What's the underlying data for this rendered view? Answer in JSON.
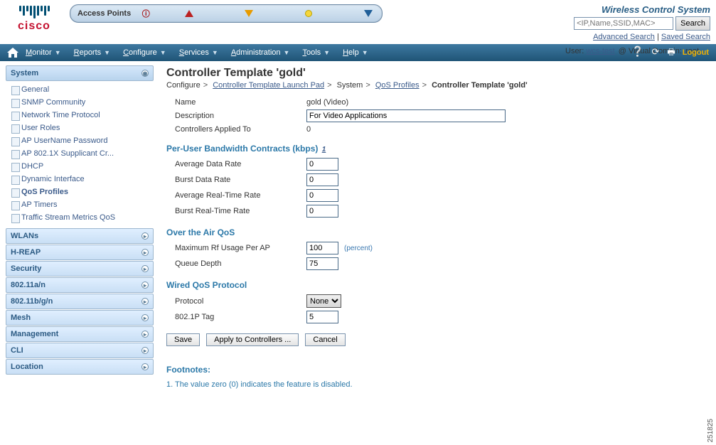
{
  "brand": "cisco",
  "quicknav_label": "Access Points",
  "app_title": "Wireless Control System",
  "search": {
    "placeholder": "<IP,Name,SSID,MAC>",
    "button": "Search",
    "advanced": "Advanced Search",
    "saved": "Saved Search"
  },
  "user_prefix": "User:",
  "user_name": "wcs-test",
  "domain_prefix": "@ Virtual Domain:",
  "domain_value": "root",
  "menubar": {
    "monitor": "Monitor",
    "reports": "Reports",
    "configure": "Configure",
    "services": "Services",
    "administration": "Administration",
    "tools": "Tools",
    "help": "Help",
    "logout": "Logout"
  },
  "sidebar": {
    "system": {
      "title": "System",
      "items": [
        "General",
        "SNMP Community",
        "Network Time Protocol",
        "User Roles",
        "AP UserName Password",
        "AP 802.1X Supplicant Cr...",
        "DHCP",
        "Dynamic Interface",
        "QoS Profiles",
        "AP Timers",
        "Traffic Stream Metrics QoS"
      ],
      "active": "QoS Profiles"
    },
    "sections": [
      "WLANs",
      "H-REAP",
      "Security",
      "802.11a/n",
      "802.11b/g/n",
      "Mesh",
      "Management",
      "CLI",
      "Location"
    ]
  },
  "page": {
    "title": "Controller Template 'gold'",
    "breadcrumb": {
      "configure": "Configure",
      "launch": "Controller Template Launch Pad",
      "system": "System",
      "qos": "QoS Profiles",
      "current": "Controller Template 'gold'"
    },
    "basic": {
      "name_label": "Name",
      "name_value": "gold (Video)",
      "desc_label": "Description",
      "desc_value": "For Video Applications",
      "applied_label": "Controllers Applied To",
      "applied_value": "0"
    },
    "section_peruser": "Per-User Bandwidth Contracts (kbps)",
    "footnote_marker": "1",
    "peruser": {
      "avg_data_label": "Average Data Rate",
      "avg_data_value": "0",
      "burst_data_label": "Burst Data Rate",
      "burst_data_value": "0",
      "avg_rt_label": "Average Real-Time Rate",
      "avg_rt_value": "0",
      "burst_rt_label": "Burst Real-Time Rate",
      "burst_rt_value": "0"
    },
    "section_ota": "Over the Air QoS",
    "ota": {
      "max_rf_label": "Maximum Rf Usage Per AP",
      "max_rf_value": "100",
      "percent": "(percent)",
      "queue_label": "Queue Depth",
      "queue_value": "75"
    },
    "section_wired": "Wired QoS Protocol",
    "wired": {
      "proto_label": "Protocol",
      "proto_value": "None",
      "tag_label": "802.1P Tag",
      "tag_value": "5"
    },
    "buttons": {
      "save": "Save",
      "apply": "Apply to Controllers ...",
      "cancel": "Cancel"
    },
    "footnotes_title": "Footnotes:",
    "footnote_1": "1. The value zero (0) indicates the feature is disabled."
  },
  "docnum": "251825"
}
